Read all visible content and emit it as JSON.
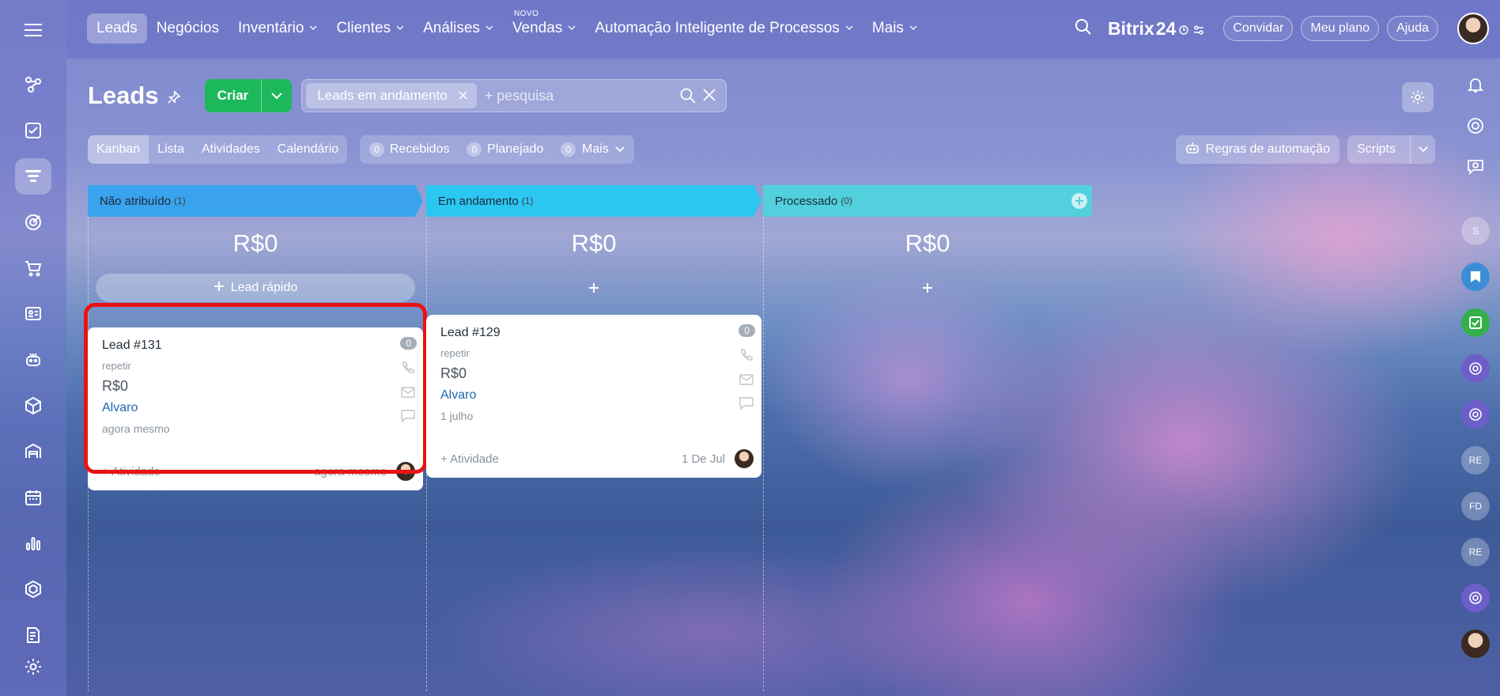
{
  "topnav": {
    "items": [
      {
        "label": "Leads",
        "active": true,
        "chevron": false,
        "badge": ""
      },
      {
        "label": "Negócios",
        "active": false,
        "chevron": false,
        "badge": ""
      },
      {
        "label": "Inventário",
        "active": false,
        "chevron": true,
        "badge": ""
      },
      {
        "label": "Clientes",
        "active": false,
        "chevron": true,
        "badge": ""
      },
      {
        "label": "Análises",
        "active": false,
        "chevron": true,
        "badge": ""
      },
      {
        "label": "Vendas",
        "active": false,
        "chevron": true,
        "badge": "NOVO"
      },
      {
        "label": "Automação Inteligente de Processos",
        "active": false,
        "chevron": true,
        "badge": ""
      },
      {
        "label": "Mais",
        "active": false,
        "chevron": true,
        "badge": ""
      }
    ],
    "brand": "Bitrix",
    "brand_num": "24",
    "invite": "Convidar",
    "plan": "Meu plano",
    "help": "Ajuda"
  },
  "header": {
    "title": "Leads",
    "create": "Criar",
    "filter_chip": "Leads em andamento",
    "search_placeholder": "+ pesquisa"
  },
  "views": {
    "tabs": [
      "Kanban",
      "Lista",
      "Atividades",
      "Calendário"
    ],
    "counters": [
      {
        "count": "0",
        "label": "Recebidos"
      },
      {
        "count": "0",
        "label": "Planejado"
      },
      {
        "count": "0",
        "label": "Mais"
      }
    ],
    "automation": "Regras de automação",
    "scripts": "Scripts"
  },
  "columns": [
    {
      "name": "Não atribuído",
      "count": "(1)",
      "total": "R$0",
      "color": "#3aa3ee",
      "quick_label": "Lead rápido",
      "card": {
        "title": "Lead #131",
        "subtitle": "repetir",
        "amount": "R$0",
        "person": "Alvaro",
        "time": "agora mesmo",
        "badge": "0",
        "activity": "+ Atividade",
        "date": "agora mesmo"
      }
    },
    {
      "name": "Em andamento",
      "count": "(1)",
      "total": "R$0",
      "color": "#2cc6f2",
      "quick_label": "",
      "card": {
        "title": "Lead #129",
        "subtitle": "repetir",
        "amount": "R$0",
        "person": "Alvaro",
        "time": "1 julho",
        "badge": "0",
        "activity": "+ Atividade",
        "date": "1 De Jul"
      }
    },
    {
      "name": "Processado",
      "count": "(0)",
      "total": "R$0",
      "color": "#52d0de",
      "quick_label": "",
      "card": null
    }
  ],
  "rightbar": {
    "initials": [
      "S",
      "RE",
      "FD",
      "RE"
    ]
  },
  "colors": {
    "accent_green": "#1cb85b",
    "highlight": "#ea1212",
    "link": "#2067b0"
  }
}
